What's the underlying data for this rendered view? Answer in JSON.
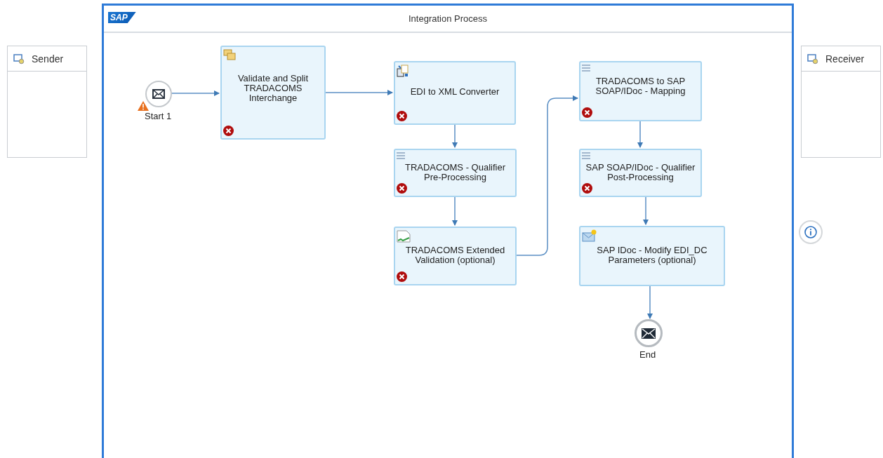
{
  "participants": [
    {
      "label": "Sender"
    },
    {
      "label": "Receiver"
    }
  ],
  "process": {
    "logo": "SAP",
    "title": "Integration Process",
    "start": {
      "label": "Start 1",
      "warning": true
    },
    "steps": [
      {
        "label": "Validate and Split\nTRADACOMS\nInterchange",
        "kind": "splitter",
        "error": true
      },
      {
        "label": "EDI to XML Converter",
        "kind": "converter",
        "error": true
      },
      {
        "label": "TRADACOMS - Qualifier\nPre-Processing",
        "kind": "mapping",
        "error": true
      },
      {
        "label": "TRADACOMS Extended\nValidation (optional)",
        "kind": "validator",
        "error": true
      },
      {
        "label": "TRADACOMS to SAP\nSOAP/IDoc - Mapping",
        "kind": "mapping",
        "error": true
      },
      {
        "label": "SAP SOAP/IDoc - Qualifier\nPost-Processing",
        "kind": "mapping",
        "error": true
      },
      {
        "label": "SAP IDoc - Modify EDI_DC\nParameters (optional)",
        "kind": "modifier",
        "error": false
      }
    ],
    "end": {
      "label": "End"
    }
  }
}
